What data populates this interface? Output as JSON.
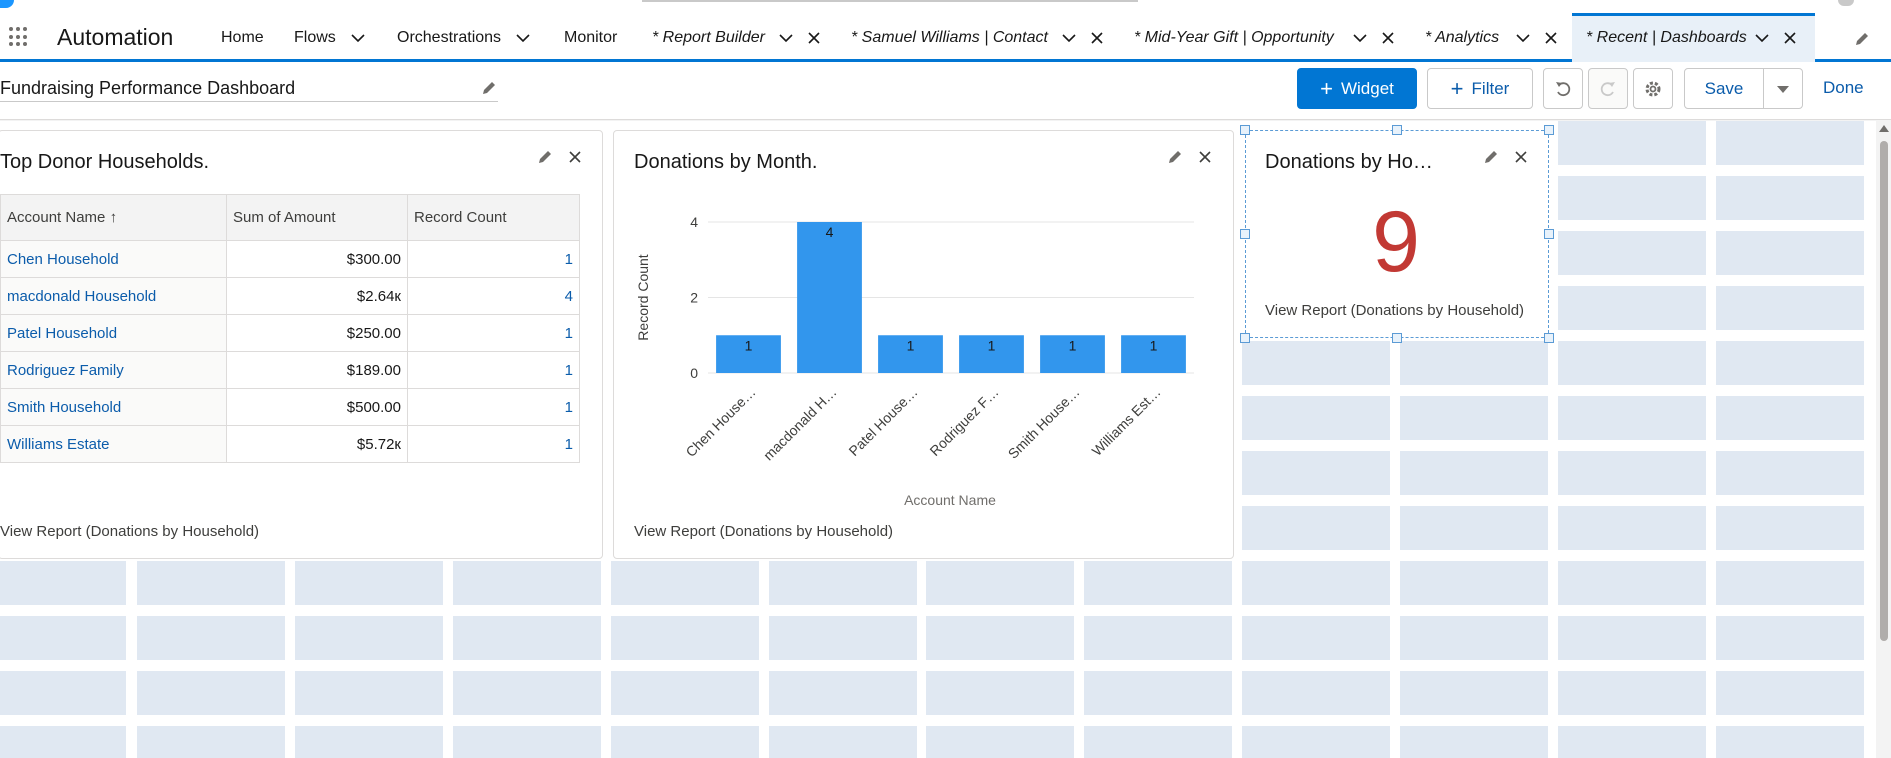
{
  "app": {
    "name": "Automation"
  },
  "nav": {
    "items": [
      {
        "label": "Home",
        "has_menu": false
      },
      {
        "label": "Flows",
        "has_menu": true
      },
      {
        "label": "Orchestrations",
        "has_menu": true
      },
      {
        "label": "Monitor",
        "has_menu": false
      }
    ],
    "tabs": [
      {
        "label": "* Report Builder",
        "active": false
      },
      {
        "label": "* Samuel Williams | Contact",
        "active": false
      },
      {
        "label": "* Mid-Year Gift | Opportunity",
        "active": false
      },
      {
        "label": "* Analytics",
        "active": false
      },
      {
        "label": "* Recent | Dashboards",
        "active": true
      }
    ]
  },
  "toolbar": {
    "dashboard_title": "Fundraising Performance Dashboard",
    "widget_label": "Widget",
    "filter_label": "Filter",
    "save_label": "Save",
    "done_label": "Done"
  },
  "widgets": {
    "table": {
      "title": "Top Donor Households.",
      "columns": [
        "Account Name",
        "Sum of Amount",
        "Record Count"
      ],
      "sort_indicator": "↑",
      "rows": [
        {
          "account": "Chen Household",
          "amount": "$300.00",
          "count": "1"
        },
        {
          "account": "macdonald Household",
          "amount": "$2.64к",
          "count": "4"
        },
        {
          "account": "Patel Household",
          "amount": "$250.00",
          "count": "1"
        },
        {
          "account": "Rodriguez Family",
          "amount": "$189.00",
          "count": "1"
        },
        {
          "account": "Smith Household",
          "amount": "$500.00",
          "count": "1"
        },
        {
          "account": "Williams Estate",
          "amount": "$5.72к",
          "count": "1"
        }
      ],
      "view_report": "View Report (Donations by Household)"
    },
    "chart": {
      "title": "Donations by Month.",
      "view_report": "View Report (Donations by Household)"
    },
    "metric": {
      "title": "Donations by Ho…",
      "value": "9",
      "view_report": "View Report (Donations by Household)"
    }
  },
  "chart_data": {
    "type": "bar",
    "categories": [
      "Chen House…",
      "macdonald H…",
      "Patel House…",
      "Rodriguez F…",
      "Smith House…",
      "Williams Est…"
    ],
    "values": [
      1,
      4,
      1,
      1,
      1,
      1
    ],
    "data_labels": [
      "1",
      "4",
      "1",
      "1",
      "1",
      "1"
    ],
    "yticks": [
      "0",
      "2",
      "4"
    ],
    "ylim": [
      0,
      4
    ],
    "xlabel": "Account Name",
    "ylabel": "Record Count",
    "grid": true,
    "bar_color": "#3296ed"
  },
  "colors": {
    "brand": "#0176d3",
    "metric_value": "#c23934",
    "link": "#0b5cab"
  }
}
